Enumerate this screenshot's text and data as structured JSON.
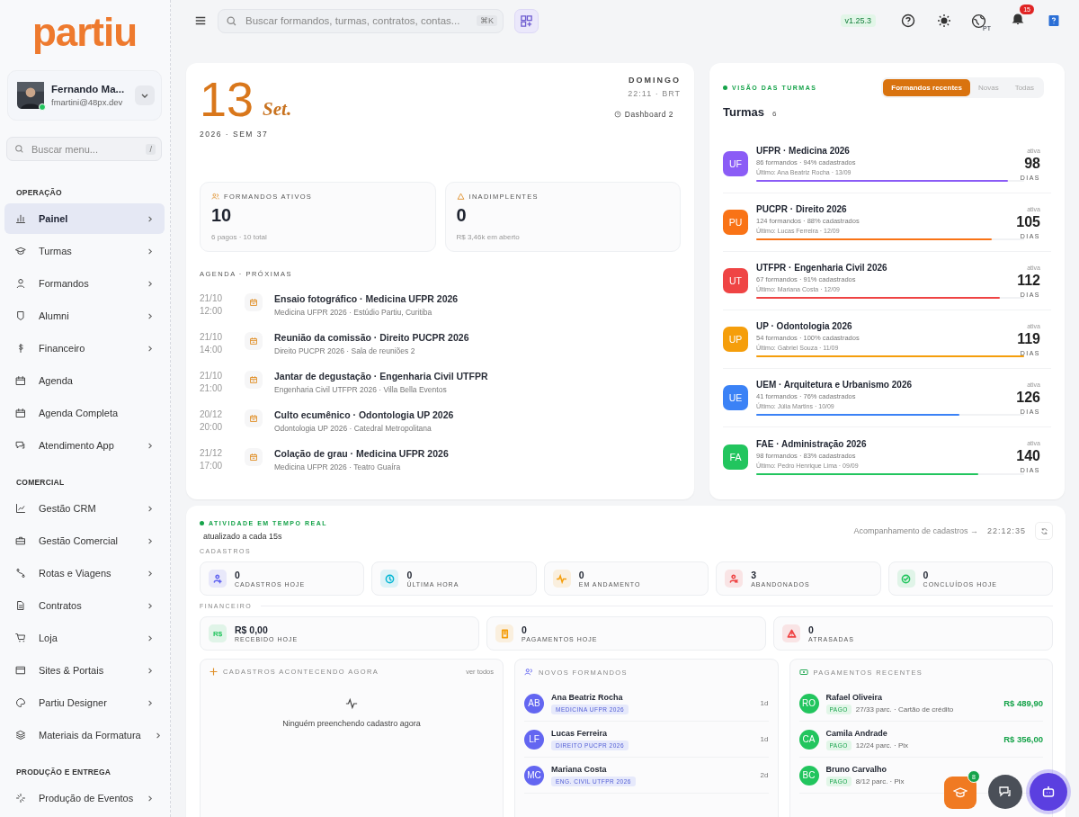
{
  "logo": {
    "text": "partiu"
  },
  "user": {
    "name": "Fernando Ma...",
    "email": "fmartini@48px.dev",
    "online": true
  },
  "menu_search": {
    "placeholder": "Buscar menu...",
    "shortcut": "/"
  },
  "sidebar": {
    "sections": [
      {
        "title": "OPERAÇÃO",
        "items": [
          {
            "label": "Painel",
            "selected": true,
            "expandable": true
          },
          {
            "label": "Turmas",
            "selected": false,
            "expandable": true
          },
          {
            "label": "Formandos",
            "selected": false,
            "expandable": true
          },
          {
            "label": "Alumni",
            "selected": false,
            "expandable": true
          },
          {
            "label": "Financeiro",
            "selected": false,
            "expandable": true
          },
          {
            "label": "Agenda",
            "selected": false,
            "expandable": false
          },
          {
            "label": "Agenda Completa",
            "selected": false,
            "expandable": false
          },
          {
            "label": "Atendimento App",
            "selected": false,
            "expandable": true
          }
        ]
      },
      {
        "title": "COMERCIAL",
        "items": [
          {
            "label": "Gestão CRM",
            "selected": false,
            "expandable": true
          },
          {
            "label": "Gestão Comercial",
            "selected": false,
            "expandable": true
          },
          {
            "label": "Rotas e Viagens",
            "selected": false,
            "expandable": true
          },
          {
            "label": "Contratos",
            "selected": false,
            "expandable": true
          },
          {
            "label": "Loja",
            "selected": false,
            "expandable": true
          },
          {
            "label": "Sites & Portais",
            "selected": false,
            "expandable": true
          },
          {
            "label": "Partiu Designer",
            "selected": false,
            "expandable": true
          },
          {
            "label": "Materiais da Formatura",
            "selected": false,
            "expandable": true
          }
        ]
      },
      {
        "title": "PRODUÇÃO E ENTREGA",
        "items": [
          {
            "label": "Produção de Eventos",
            "selected": false,
            "expandable": true
          }
        ]
      }
    ]
  },
  "topbar": {
    "search_placeholder": "Buscar formandos, turmas, contratos, contas...",
    "shortcut": "⌘K",
    "version": "v1.25.3",
    "language": "PT",
    "notifications": "15"
  },
  "date_card": {
    "day": "13",
    "month": "Set.",
    "year_week": "2026 · SEM 37",
    "weekday": "DOMINGO",
    "time": "22:11 · BRT",
    "dashboard": "Dashboard 2",
    "stats": [
      {
        "label": "FORMANDOS ATIVOS",
        "value": "10",
        "note": "6 pagos · 10 total"
      },
      {
        "label": "INADIMPLENTES",
        "value": "0",
        "note": "R$ 3,46k em aberto"
      }
    ],
    "agenda_title": "AGENDA · PRÓXIMAS",
    "events": [
      {
        "date": "21/10",
        "time": "12:00",
        "title": "Ensaio fotográfico · Medicina UFPR 2026",
        "detail": "Medicina UFPR 2026 · Estúdio Partiu, Curitiba"
      },
      {
        "date": "21/10",
        "time": "14:00",
        "title": "Reunião da comissão · Direito PUCPR 2026",
        "detail": "Direito PUCPR 2026 · Sala de reuniões 2"
      },
      {
        "date": "21/10",
        "time": "21:00",
        "title": "Jantar de degustação · Engenharia Civil UTFPR",
        "detail": "Engenharia Civil UTFPR 2026 · Villa Bella Eventos"
      },
      {
        "date": "20/12",
        "time": "20:00",
        "title": "Culto ecumênico · Odontologia UP 2026",
        "detail": "Odontologia UP 2026 · Catedral Metropolitana"
      },
      {
        "date": "21/12",
        "time": "17:00",
        "title": "Colação de grau · Medicina UFPR 2026",
        "detail": "Medicina UFPR 2026 · Teatro Guaíra"
      }
    ]
  },
  "turmas_card": {
    "label": "VISÃO DAS TURMAS",
    "title": "Turmas",
    "count": "6",
    "tabs": [
      {
        "label": "Formandos recentes",
        "selected": true
      },
      {
        "label": "Novas",
        "selected": false
      },
      {
        "label": "Todas",
        "selected": false
      }
    ],
    "rows": [
      {
        "initials": "UF",
        "color": "#8b5cf6",
        "name": "UFPR · Medicina 2026",
        "stats": "86 formandos · 94% cadastrados",
        "last": "Último: Ana Beatriz Rocha · 13/09",
        "level": 0.94,
        "status": "ativa",
        "days": "98",
        "unit": "DIAS"
      },
      {
        "initials": "PU",
        "color": "#f97316",
        "name": "PUCPR · Direito 2026",
        "stats": "124 formandos · 88% cadastrados",
        "last": "Último: Lucas Ferreira · 12/09",
        "level": 0.88,
        "status": "ativa",
        "days": "105",
        "unit": "DIAS"
      },
      {
        "initials": "UT",
        "color": "#ef4444",
        "name": "UTFPR · Engenharia Civil 2026",
        "stats": "67 formandos · 91% cadastrados",
        "last": "Último: Mariana Costa · 12/09",
        "level": 0.91,
        "status": "ativa",
        "days": "112",
        "unit": "DIAS"
      },
      {
        "initials": "UP",
        "color": "#f59e0b",
        "name": "UP · Odontologia 2026",
        "stats": "54 formandos · 100% cadastrados",
        "last": "Último: Gabriel Souza · 11/09",
        "level": 1,
        "status": "ativa",
        "days": "119",
        "unit": "DIAS"
      },
      {
        "initials": "UE",
        "color": "#3b82f6",
        "name": "UEM · Arquitetura e Urbanismo 2026",
        "stats": "41 formandos · 76% cadastrados",
        "last": "Último: Júlia Martins · 10/09",
        "level": 0.76,
        "status": "ativa",
        "days": "126",
        "unit": "DIAS"
      },
      {
        "initials": "FA",
        "color": "#22c55e",
        "name": "FAE · Administração 2026",
        "stats": "98 formandos · 83% cadastrados",
        "last": "Último: Pedro Henrique Lima · 09/09",
        "level": 0.83,
        "status": "ativa",
        "days": "140",
        "unit": "DIAS"
      }
    ]
  },
  "activity": {
    "label": "ATIVIDADE EM TEMPO REAL",
    "subtitle": "atualizado a cada 15s",
    "link": "Acompanhamento de cadastros →",
    "time": "22:12:35",
    "cadastros_title": "CADASTROS",
    "cadastros": [
      {
        "value": "0",
        "label": "CADASTROS HOJE",
        "color": "#6366f1"
      },
      {
        "value": "0",
        "label": "ÚLTIMA HORA",
        "color": "#06b6d4"
      },
      {
        "value": "0",
        "label": "EM ANDAMENTO",
        "color": "#f59e0b"
      },
      {
        "value": "3",
        "label": "ABANDONADOS",
        "color": "#ef4444"
      },
      {
        "value": "0",
        "label": "CONCLUÍDOS HOJE",
        "color": "#22c55e"
      }
    ],
    "financeiro_title": "FINANCEIRO",
    "financeiro": [
      {
        "value": "R$ 0,00",
        "label": "RECEBIDO HOJE",
        "color": "#22c55e",
        "icon_text": "R$"
      },
      {
        "value": "0",
        "label": "PAGAMENTOS HOJE",
        "color": "#f59e0b"
      },
      {
        "value": "0",
        "label": "ATRASADAS",
        "color": "#ef4444"
      }
    ]
  },
  "live_panel": {
    "title": "CADASTROS ACONTECENDO AGORA",
    "link": "ver todos",
    "empty": "Ninguém preenchendo cadastro agora"
  },
  "new_panel": {
    "title": "NOVOS FORMANDOS",
    "items": [
      {
        "initials": "AB",
        "name": "Ana Beatriz Rocha",
        "tag": "MEDICINA UFPR 2026",
        "age": "1d"
      },
      {
        "initials": "LF",
        "name": "Lucas Ferreira",
        "tag": "DIREITO PUCPR 2026",
        "age": "1d"
      },
      {
        "initials": "MC",
        "name": "Mariana Costa",
        "tag": "ENG. CIVIL UTFPR 2026",
        "age": "2d"
      }
    ]
  },
  "payments_panel": {
    "title": "PAGAMENTOS RECENTES",
    "items": [
      {
        "initials": "RO",
        "name": "Rafael Oliveira",
        "status": "PAGO",
        "detail": "27/33 parc. · Cartão de crédito",
        "amount": "R$ 489,90"
      },
      {
        "initials": "CA",
        "name": "Camila Andrade",
        "status": "PAGO",
        "detail": "12/24 parc. · Pix",
        "amount": "R$ 356,00"
      },
      {
        "initials": "BC",
        "name": "Bruno Carvalho",
        "status": "PAGO",
        "detail": "8/12 parc. · Pix"
      }
    ]
  },
  "floating": {
    "badge": "8"
  }
}
